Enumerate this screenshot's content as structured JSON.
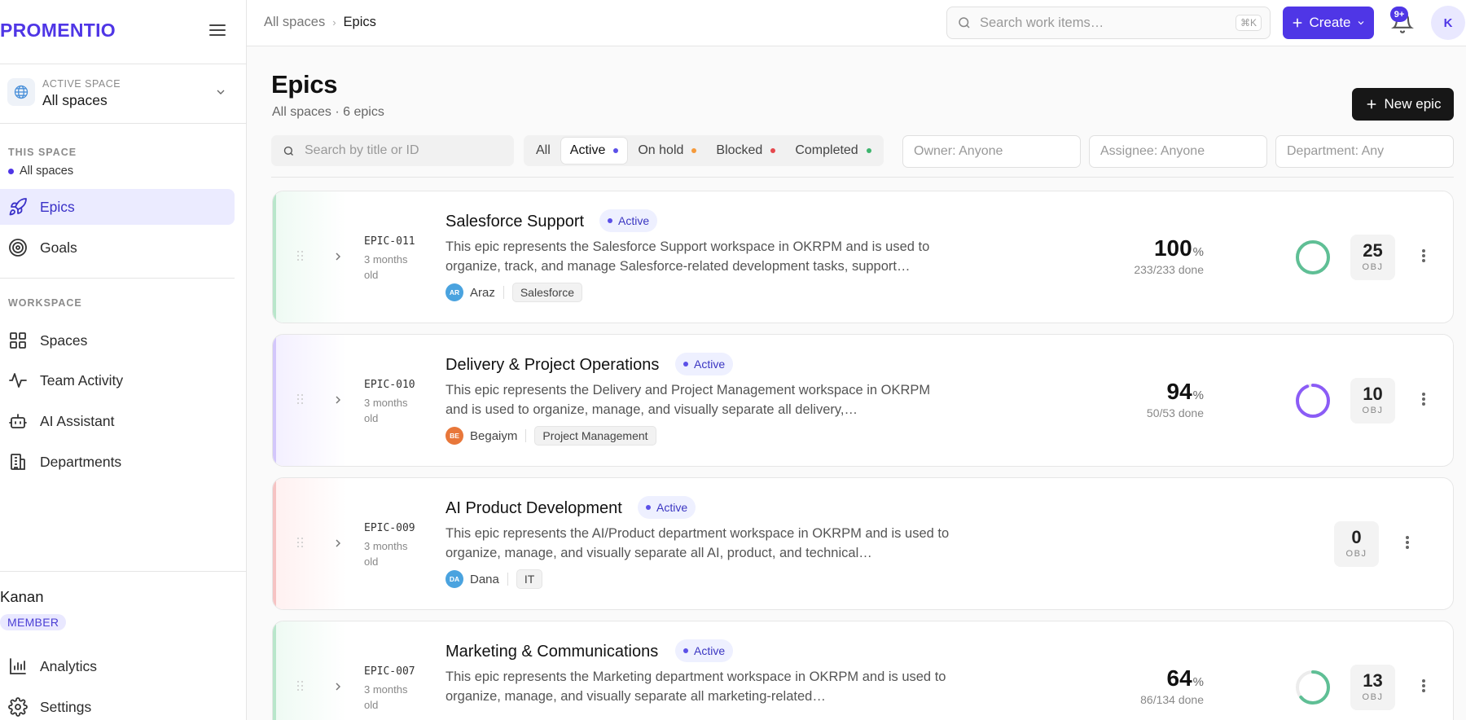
{
  "app": {
    "logo": "PROMENTIO"
  },
  "sidebar": {
    "active_space_caption": "ACTIVE SPACE",
    "active_space_name": "All spaces",
    "this_space_label": "THIS SPACE",
    "this_space_item": "All spaces",
    "nav_top": [
      {
        "label": "Epics",
        "icon": "rocket-icon",
        "active": true
      },
      {
        "label": "Goals",
        "icon": "target-icon",
        "active": false
      }
    ],
    "workspace_label": "WORKSPACE",
    "nav_workspace": [
      {
        "label": "Spaces",
        "icon": "grid-icon"
      },
      {
        "label": "Team Activity",
        "icon": "activity-icon"
      },
      {
        "label": "AI Assistant",
        "icon": "robot-icon"
      },
      {
        "label": "Departments",
        "icon": "building-icon"
      }
    ],
    "user": {
      "name": "Kanan",
      "role": "MEMBER"
    },
    "nav_bottom": [
      {
        "label": "Analytics",
        "icon": "bar-chart-icon"
      },
      {
        "label": "Settings",
        "icon": "gear-icon"
      }
    ]
  },
  "topbar": {
    "breadcrumb": [
      "All spaces",
      "Epics"
    ],
    "search_placeholder": "Search work items…",
    "search_shortcut": "⌘K",
    "create_label": "Create",
    "notification_count": "9+",
    "avatar_initial": "K"
  },
  "page": {
    "title": "Epics",
    "subtitle": "All spaces · 6 epics",
    "new_button": "New epic"
  },
  "filters": {
    "search_placeholder": "Search by title or ID",
    "tabs": [
      {
        "label": "All",
        "active": false,
        "dot": null
      },
      {
        "label": "Active",
        "active": true,
        "dot": "#5b50e8"
      },
      {
        "label": "On hold",
        "active": false,
        "dot": "#f59a3c"
      },
      {
        "label": "Blocked",
        "active": false,
        "dot": "#e5484d"
      },
      {
        "label": "Completed",
        "active": false,
        "dot": "#3db46d"
      }
    ],
    "owner": "Owner: Anyone",
    "assignee": "Assignee: Anyone",
    "department": "Department: Any"
  },
  "colors": {
    "accent": "#4f36e6",
    "ring_green": "#5fbf95",
    "ring_purple": "#8b5cf6"
  },
  "epics": [
    {
      "id": "EPIC-011",
      "age": "3 months old",
      "title": "Salesforce Support",
      "status": "Active",
      "description": "This epic represents the Salesforce Support workspace in OKRPM and is used to organize, track, and manage Salesforce-related development tasks, support…",
      "owner_initials": "AR",
      "owner": "Araz",
      "owner_color": "#4aa3df",
      "tag": "Salesforce",
      "progress_pct": "100",
      "progress_done": "233/233 done",
      "progress": 1.0,
      "ring_color": "#5fbf95",
      "objectives": "25",
      "obj_label": "OBJ"
    },
    {
      "id": "EPIC-010",
      "age": "3 months old",
      "title": "Delivery & Project Operations",
      "status": "Active",
      "description": "This epic represents the Delivery and Project Management workspace in OKRPM and is used to organize, manage, and visually separate all delivery,…",
      "owner_initials": "BE",
      "owner": "Begaiym",
      "owner_color": "#e8773a",
      "tag": "Project Management",
      "progress_pct": "94",
      "progress_done": "50/53 done",
      "progress": 0.94,
      "ring_color": "#8b5cf6",
      "objectives": "10",
      "obj_label": "OBJ"
    },
    {
      "id": "EPIC-009",
      "age": "3 months old",
      "title": "AI Product Development",
      "status": "Active",
      "description": "This epic represents the AI/Product department workspace in OKRPM and is used to organize, manage, and visually separate all AI, product, and technical…",
      "owner_initials": "DA",
      "owner": "Dana",
      "owner_color": "#4aa3df",
      "tag": "IT",
      "objectives": "0",
      "obj_label": "OBJ"
    },
    {
      "id": "EPIC-007",
      "age": "3 months old",
      "title": "Marketing & Communications",
      "status": "Active",
      "description": "This epic represents the Marketing department workspace in OKRPM and is used to organize, manage, and visually separate all marketing-related…",
      "progress_pct": "64",
      "progress_done": "86/134 done",
      "progress": 0.64,
      "ring_color": "#5fbf95",
      "objectives": "13",
      "obj_label": "OBJ"
    }
  ]
}
